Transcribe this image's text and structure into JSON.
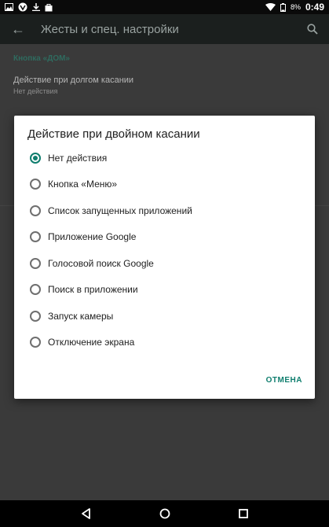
{
  "status": {
    "battery": "8%",
    "time": "0:49"
  },
  "toolbar": {
    "title": "Жесты и спец. настройки"
  },
  "settings": {
    "section_header": "Кнопка «ДОМ»",
    "long_press": {
      "title": "Действие при долгом касании",
      "subtitle": "Нет действия"
    }
  },
  "dialog": {
    "title": "Действие при двойном касании",
    "options": [
      "Нет действия",
      "Кнопка «Меню»",
      "Список запущенных приложений",
      "Приложение Google",
      "Голосовой поиск Google",
      "Поиск в приложении",
      "Запуск камеры",
      "Отключение экрана"
    ],
    "selected_index": 0,
    "cancel_label": "ОТМЕНА"
  },
  "colors": {
    "accent": "#0f7e6e"
  },
  "icons": {
    "back": "back-arrow-icon",
    "search": "search-icon",
    "nav": [
      "nav-back-icon",
      "nav-home-icon",
      "nav-recents-icon"
    ]
  }
}
